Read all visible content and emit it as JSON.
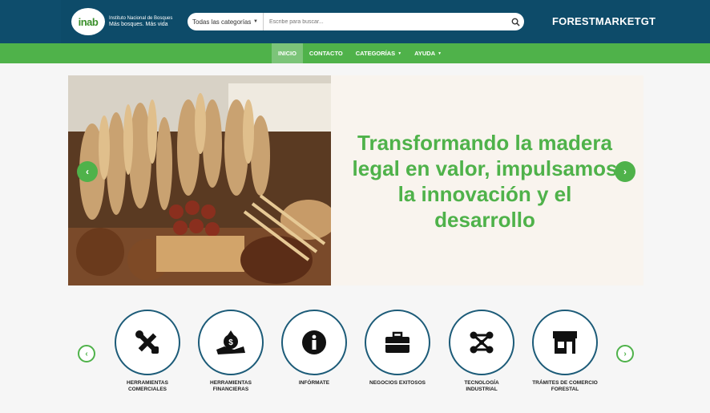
{
  "header": {
    "logo_text": "inab",
    "org_name": "Instituto Nacional de Bosques",
    "org_tagline": "Más bosques. Más vida",
    "search_category": "Todas las categorías",
    "search_placeholder": "Escribe para buscar...",
    "brand": "FORESTMARKETGT"
  },
  "nav": {
    "items": [
      {
        "label": "INICIO",
        "active": true
      },
      {
        "label": "CONTACTO"
      },
      {
        "label": "CATEGORÍAS"
      },
      {
        "label": "AYUDA"
      }
    ]
  },
  "hero": {
    "headline": "Transformando la madera legal en valor, impulsamos la innovación y el desarrollo"
  },
  "categories": [
    {
      "label": "HERRAMIENTAS COMERCIALES",
      "icon": "tools-icon"
    },
    {
      "label": "HERRAMIENTAS FINANCIERAS",
      "icon": "money-bag-icon"
    },
    {
      "label": "INFÓRMATE",
      "icon": "info-icon"
    },
    {
      "label": "NEGOCIOS EXITOSOS",
      "icon": "briefcase-icon"
    },
    {
      "label": "TECNOLOGÍA INDUSTRIAL",
      "icon": "network-nodes-icon"
    },
    {
      "label": "TRÁMITES DE COMERCIO FORESTAL",
      "icon": "storefront-icon"
    }
  ],
  "colors": {
    "header_bg": "#0e4d6c",
    "nav_green": "#4fb24a",
    "circle_border": "#1c5b78"
  }
}
